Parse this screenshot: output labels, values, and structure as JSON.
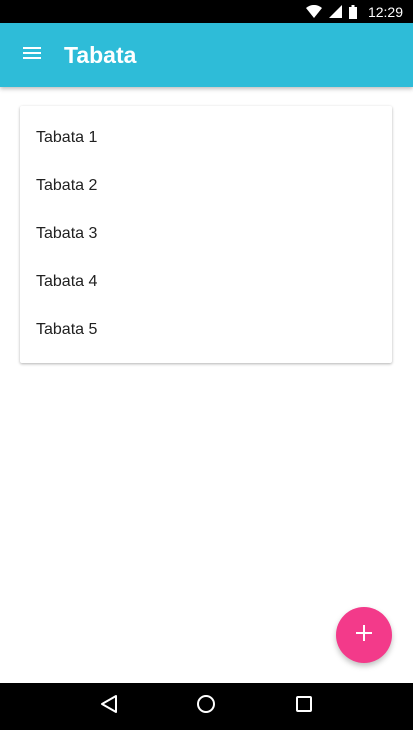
{
  "status_bar": {
    "time": "12:29",
    "icons": [
      "wifi-icon",
      "signal-icon",
      "battery-icon"
    ]
  },
  "app_bar": {
    "title": "Tabata",
    "menu_icon": "menu-icon",
    "color": "#2ebcd8"
  },
  "list": {
    "items": [
      {
        "label": "Tabata 1"
      },
      {
        "label": "Tabata 2"
      },
      {
        "label": "Tabata 3"
      },
      {
        "label": "Tabata 4"
      },
      {
        "label": "Tabata 5"
      }
    ]
  },
  "fab": {
    "icon": "plus-icon",
    "color": "#f33a8a"
  },
  "nav_bar": {
    "buttons": [
      "back-icon",
      "home-icon",
      "recents-icon"
    ]
  }
}
